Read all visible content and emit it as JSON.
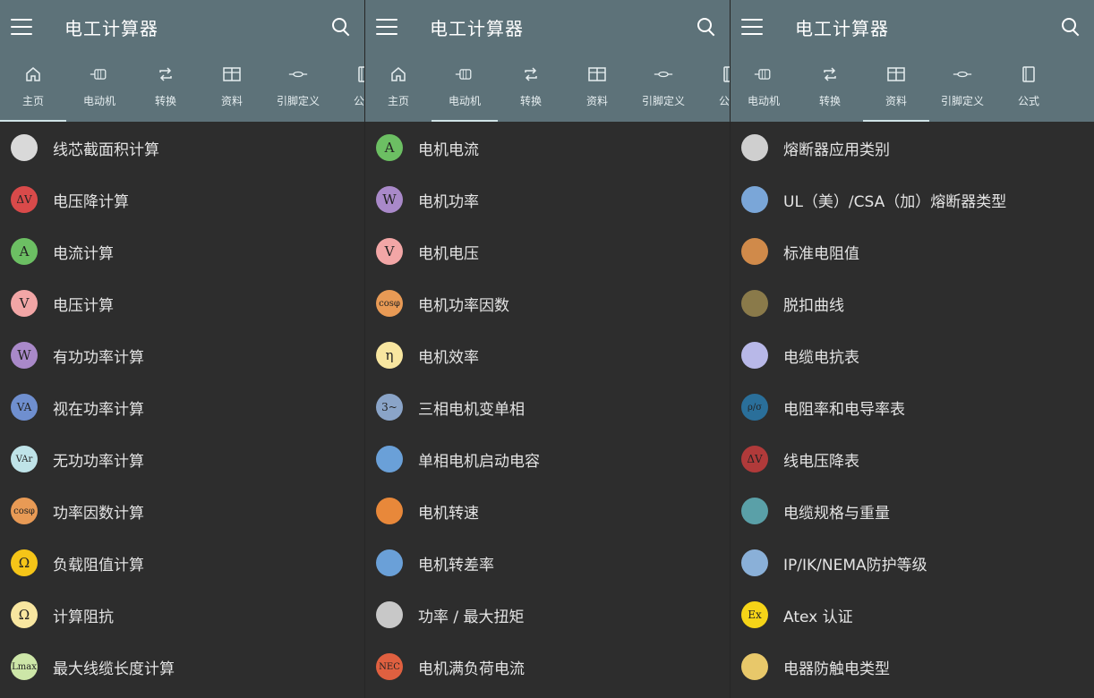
{
  "screens": [
    {
      "title": "电工计算器",
      "tabs": [
        {
          "label": "主页",
          "icon": "home-icon"
        },
        {
          "label": "电动机",
          "icon": "motor-icon"
        },
        {
          "label": "转换",
          "icon": "repeat-icon"
        },
        {
          "label": "资料",
          "icon": "table-icon"
        },
        {
          "label": "引脚定义",
          "icon": "connector-icon"
        },
        {
          "label": "公式",
          "icon": "book-icon"
        }
      ],
      "active_tab": "主页",
      "items": [
        {
          "label": "线芯截面积计算",
          "icon_text": "",
          "icon": "cable-cross-section-icon",
          "color": "#d9d9d9"
        },
        {
          "label": "电压降计算",
          "icon_text": "ΔV",
          "icon": "voltage-drop-icon",
          "color": "#d94a4a"
        },
        {
          "label": "电流计算",
          "icon_text": "A",
          "icon": "ampere-icon",
          "color": "#6cbf63"
        },
        {
          "label": "电压计算",
          "icon_text": "V",
          "icon": "volt-icon",
          "color": "#f2a6a6"
        },
        {
          "label": "有功功率计算",
          "icon_text": "W",
          "icon": "watt-icon",
          "color": "#a989c9"
        },
        {
          "label": "视在功率计算",
          "icon_text": "VA",
          "icon": "va-icon",
          "color": "#6f8fcf"
        },
        {
          "label": "无功功率计算",
          "icon_text": "VAr",
          "icon": "var-icon",
          "color": "#bfe3e8"
        },
        {
          "label": "功率因数计算",
          "icon_text": "cosφ",
          "icon": "cos-phi-icon",
          "color": "#e89a55"
        },
        {
          "label": "负载阻值计算",
          "icon_text": "Ω",
          "icon": "ohm-icon",
          "color": "#f5c518"
        },
        {
          "label": "计算阻抗",
          "icon_text": "Ω",
          "icon": "impedance-icon",
          "color": "#f8e6a0"
        },
        {
          "label": "最大线缆长度计算",
          "icon_text": "Lmax",
          "icon": "max-length-icon",
          "color": "#cde6a8"
        }
      ]
    },
    {
      "title": "电工计算器",
      "tabs": [
        {
          "label": "主页",
          "icon": "home-icon"
        },
        {
          "label": "电动机",
          "icon": "motor-icon"
        },
        {
          "label": "转换",
          "icon": "repeat-icon"
        },
        {
          "label": "资料",
          "icon": "table-icon"
        },
        {
          "label": "引脚定义",
          "icon": "connector-icon"
        },
        {
          "label": "公式",
          "icon": "book-icon"
        }
      ],
      "active_tab": "电动机",
      "items": [
        {
          "label": "电机电流",
          "icon_text": "A",
          "icon": "ampere-icon",
          "color": "#6cbf63"
        },
        {
          "label": "电机功率",
          "icon_text": "W",
          "icon": "watt-icon",
          "color": "#a989c9"
        },
        {
          "label": "电机电压",
          "icon_text": "V",
          "icon": "volt-icon",
          "color": "#f2a6a6"
        },
        {
          "label": "电机功率因数",
          "icon_text": "cosφ",
          "icon": "cos-phi-icon",
          "color": "#e89a55"
        },
        {
          "label": "电机效率",
          "icon_text": "η",
          "icon": "efficiency-icon",
          "color": "#f8e6a0"
        },
        {
          "label": "三相电机变单相",
          "icon_text": "3~",
          "icon": "phase-convert-icon",
          "color": "#8aa4c8"
        },
        {
          "label": "单相电机启动电容",
          "icon_text": "",
          "icon": "capacitor-icon",
          "color": "#6aa0d8"
        },
        {
          "label": "电机转速",
          "icon_text": "",
          "icon": "rotation-icon",
          "color": "#e8883a"
        },
        {
          "label": "电机转差率",
          "icon_text": "",
          "icon": "slip-icon",
          "color": "#6aa0d8"
        },
        {
          "label": "功率 / 最大扭矩",
          "icon_text": "",
          "icon": "torque-icon",
          "color": "#c8c8c8"
        },
        {
          "label": "电机满负荷电流",
          "icon_text": "NEC",
          "icon": "nec-icon",
          "color": "#e06040"
        }
      ]
    },
    {
      "title": "电工计算器",
      "tabs": [
        {
          "label": "电动机",
          "icon": "motor-icon"
        },
        {
          "label": "转换",
          "icon": "repeat-icon"
        },
        {
          "label": "资料",
          "icon": "table-icon"
        },
        {
          "label": "引脚定义",
          "icon": "connector-icon"
        },
        {
          "label": "公式",
          "icon": "book-icon"
        }
      ],
      "active_tab": "资料",
      "items": [
        {
          "label": "熔断器应用类别",
          "icon_text": "",
          "icon": "fuse-icon",
          "color": "#cfcfcf"
        },
        {
          "label": "UL（美）/CSA（加）熔断器类型",
          "icon_text": "",
          "icon": "fuse-type-icon",
          "color": "#7aa6d8"
        },
        {
          "label": "标准电阻值",
          "icon_text": "",
          "icon": "resistor-icon",
          "color": "#d08a4a"
        },
        {
          "label": "脱扣曲线",
          "icon_text": "",
          "icon": "trip-curve-icon",
          "color": "#8a7a4a"
        },
        {
          "label": "电缆电抗表",
          "icon_text": "",
          "icon": "cable-reactance-icon",
          "color": "#b8b8e8"
        },
        {
          "label": "电阻率和电导率表",
          "icon_text": "ρ/σ",
          "icon": "resistivity-icon",
          "color": "#2a6f9a"
        },
        {
          "label": "线电压降表",
          "icon_text": "ΔV",
          "icon": "line-voltage-drop-icon",
          "color": "#b03a3a"
        },
        {
          "label": "电缆规格与重量",
          "icon_text": "",
          "icon": "cable-weight-icon",
          "color": "#5aa0a8"
        },
        {
          "label": "IP/IK/NEMA防护等级",
          "icon_text": "",
          "icon": "protection-icon",
          "color": "#8ab0d8"
        },
        {
          "label": "Atex 认证",
          "icon_text": "Ex",
          "icon": "atex-icon",
          "color": "#f5d418"
        },
        {
          "label": "电器防触电类型",
          "icon_text": "",
          "icon": "insulation-class-icon",
          "color": "#e8c86a"
        }
      ]
    }
  ]
}
